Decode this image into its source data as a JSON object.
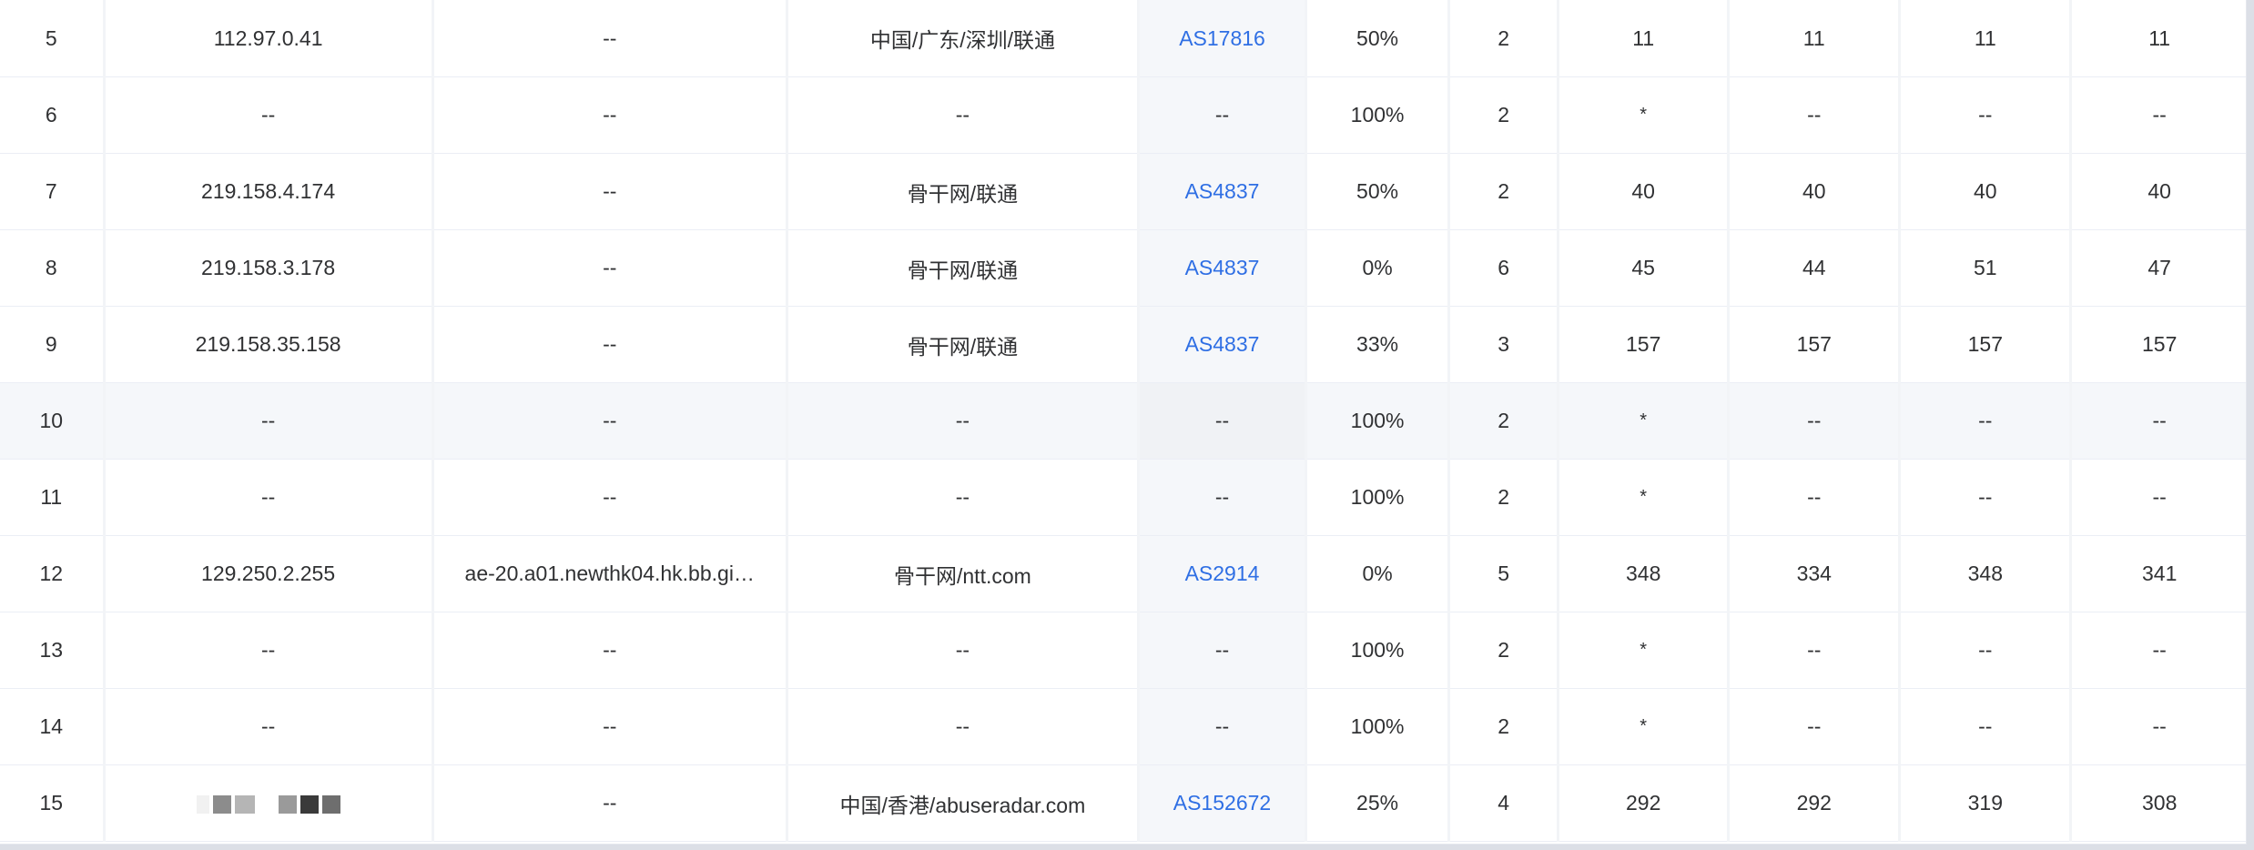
{
  "table": {
    "rows": [
      {
        "hop": "5",
        "ip": "112.97.0.41",
        "host": "--",
        "location": "中国/广东/深圳/联通",
        "asn": "AS17816",
        "loss": "50%",
        "sent": "2",
        "last": "11",
        "avg": "11",
        "best": "11",
        "worst": "11",
        "highlight": false,
        "ip_redacted": false
      },
      {
        "hop": "6",
        "ip": "--",
        "host": "--",
        "location": "--",
        "asn": "--",
        "loss": "100%",
        "sent": "2",
        "last": "*",
        "avg": "--",
        "best": "--",
        "worst": "--",
        "highlight": false,
        "ip_redacted": false
      },
      {
        "hop": "7",
        "ip": "219.158.4.174",
        "host": "--",
        "location": "骨干网/联通",
        "asn": "AS4837",
        "loss": "50%",
        "sent": "2",
        "last": "40",
        "avg": "40",
        "best": "40",
        "worst": "40",
        "highlight": false,
        "ip_redacted": false
      },
      {
        "hop": "8",
        "ip": "219.158.3.178",
        "host": "--",
        "location": "骨干网/联通",
        "asn": "AS4837",
        "loss": "0%",
        "sent": "6",
        "last": "45",
        "avg": "44",
        "best": "51",
        "worst": "47",
        "highlight": false,
        "ip_redacted": false
      },
      {
        "hop": "9",
        "ip": "219.158.35.158",
        "host": "--",
        "location": "骨干网/联通",
        "asn": "AS4837",
        "loss": "33%",
        "sent": "3",
        "last": "157",
        "avg": "157",
        "best": "157",
        "worst": "157",
        "highlight": false,
        "ip_redacted": false
      },
      {
        "hop": "10",
        "ip": "--",
        "host": "--",
        "location": "--",
        "asn": "--",
        "loss": "100%",
        "sent": "2",
        "last": "*",
        "avg": "--",
        "best": "--",
        "worst": "--",
        "highlight": true,
        "ip_redacted": false
      },
      {
        "hop": "11",
        "ip": "--",
        "host": "--",
        "location": "--",
        "asn": "--",
        "loss": "100%",
        "sent": "2",
        "last": "*",
        "avg": "--",
        "best": "--",
        "worst": "--",
        "highlight": false,
        "ip_redacted": false
      },
      {
        "hop": "12",
        "ip": "129.250.2.255",
        "host": "ae-20.a01.newthk04.hk.bb.gi…",
        "location": "骨干网/ntt.com",
        "asn": "AS2914",
        "loss": "0%",
        "sent": "5",
        "last": "348",
        "avg": "334",
        "best": "348",
        "worst": "341",
        "highlight": false,
        "ip_redacted": false
      },
      {
        "hop": "13",
        "ip": "--",
        "host": "--",
        "location": "--",
        "asn": "--",
        "loss": "100%",
        "sent": "2",
        "last": "*",
        "avg": "--",
        "best": "--",
        "worst": "--",
        "highlight": false,
        "ip_redacted": false
      },
      {
        "hop": "14",
        "ip": "--",
        "host": "--",
        "location": "--",
        "asn": "--",
        "loss": "100%",
        "sent": "2",
        "last": "*",
        "avg": "--",
        "best": "--",
        "worst": "--",
        "highlight": false,
        "ip_redacted": false
      },
      {
        "hop": "15",
        "ip": "",
        "host": "--",
        "location": "中国/香港/abuseradar.com",
        "asn": "AS152672",
        "loss": "25%",
        "sent": "4",
        "last": "292",
        "avg": "292",
        "best": "319",
        "worst": "308",
        "highlight": false,
        "ip_redacted": true
      }
    ]
  },
  "colors": {
    "link": "#2f6fe4",
    "text": "#303133",
    "row_highlight": "#f5f7fa",
    "border": "#ebeef5"
  }
}
